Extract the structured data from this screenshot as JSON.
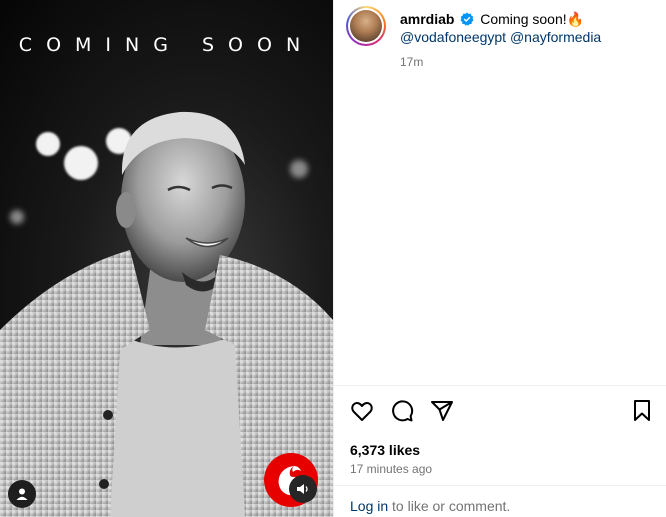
{
  "media": {
    "overlay_text": "COMING SOON",
    "brand": "vodafone-logo",
    "user_tag_icon": "person-icon",
    "sound_icon": "speaker-icon"
  },
  "post": {
    "username": "amrdiab",
    "verified": true,
    "caption_text": "Coming soon!",
    "caption_emoji": "🔥",
    "mentions": [
      "@vodafoneegypt",
      "@nayformedia"
    ],
    "time_short": "17m",
    "likes": "6,373 likes",
    "time_long": "17 minutes ago"
  },
  "actions": {
    "like_icon": "heart-icon",
    "comment_icon": "comment-icon",
    "share_icon": "share-icon",
    "save_icon": "bookmark-icon"
  },
  "login": {
    "link_text": "Log in",
    "rest_text": " to like or comment."
  },
  "colors": {
    "link": "#00376b",
    "secondary": "#737373",
    "verified": "#0095f6",
    "vodafone_red": "#e60000"
  }
}
